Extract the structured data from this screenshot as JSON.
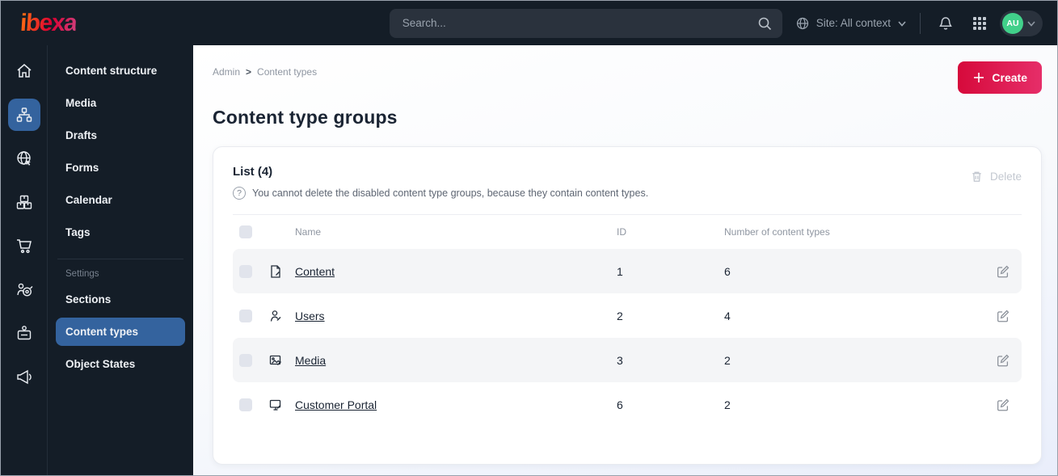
{
  "colors": {
    "brand_pink": "#db0032",
    "create_gradient": [
      "#d60a3b",
      "#e62e69"
    ],
    "active_blue": "#34639e",
    "topbar_bg": "#141d27",
    "avatar_green": "#41d08a",
    "row_stripe": "#f4f5f7"
  },
  "icons": {
    "topbar": [
      "search-icon",
      "globe-icon",
      "chevron-down-icon",
      "bell-icon",
      "apps-grid-icon"
    ],
    "rail": [
      "home-icon",
      "sitemap-icon",
      "globe-cursor-icon",
      "packages-icon",
      "cart-icon",
      "target-icon",
      "badge-icon",
      "megaphone-icon"
    ],
    "card": [
      "question-circle-icon",
      "trash-icon",
      "edit-icon"
    ],
    "rows": [
      "file-icon",
      "user-icon",
      "image-icon",
      "monitor-icon"
    ]
  },
  "topbar": {
    "logo": "ibexa",
    "search_placeholder": "Search...",
    "site_context": "Site: All context",
    "avatar_initials": "AU"
  },
  "sidebar": {
    "items": [
      {
        "label": "Content structure"
      },
      {
        "label": "Media"
      },
      {
        "label": "Drafts"
      },
      {
        "label": "Forms"
      },
      {
        "label": "Calendar"
      },
      {
        "label": "Tags"
      }
    ],
    "settings_label": "Settings",
    "settings_items": [
      {
        "label": "Sections"
      },
      {
        "label": "Content types"
      },
      {
        "label": "Object States"
      }
    ]
  },
  "main": {
    "breadcrumb": {
      "root": "Admin",
      "separator": ">",
      "current": "Content types"
    },
    "create_label": "Create",
    "title": "Content type groups",
    "card": {
      "list_title": "List (4)",
      "info_text": "You cannot delete the disabled content type groups, because they contain content types.",
      "delete_label": "Delete",
      "table": {
        "headers": {
          "name": "Name",
          "id": "ID",
          "count": "Number of content types"
        },
        "rows": [
          {
            "name": "Content",
            "id": "1",
            "count": "6",
            "icon": "file-icon"
          },
          {
            "name": "Users",
            "id": "2",
            "count": "4",
            "icon": "user-icon"
          },
          {
            "name": "Media",
            "id": "3",
            "count": "2",
            "icon": "image-icon"
          },
          {
            "name": "Customer Portal",
            "id": "6",
            "count": "2",
            "icon": "monitor-icon"
          }
        ]
      }
    }
  }
}
